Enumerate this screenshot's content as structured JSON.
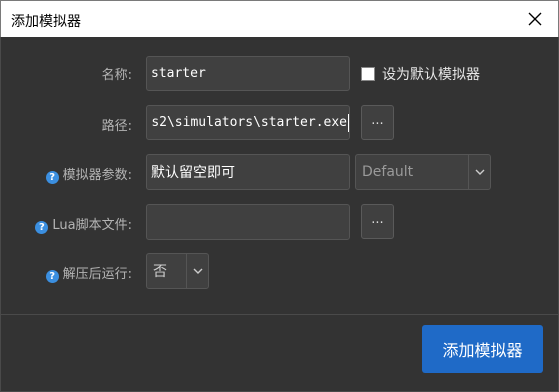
{
  "window": {
    "title": "添加模拟器",
    "close_icon": "close-icon"
  },
  "form": {
    "name": {
      "label": "名称:",
      "value": "starter",
      "default_checkbox_label": "设为默认模拟器",
      "default_checked": false
    },
    "path": {
      "label": "路径:",
      "value": "s2\\simulators\\starter.exe",
      "browse_label": "..."
    },
    "params": {
      "label": "模拟器参数:",
      "help_icon": "help-icon",
      "value": "默认留空即可",
      "preset_value": "Default"
    },
    "lua": {
      "label": "Lua脚本文件:",
      "help_icon": "help-icon",
      "value": "",
      "browse_label": "..."
    },
    "run_after": {
      "label": "解压后运行:",
      "help_icon": "help-icon",
      "value": "否"
    }
  },
  "actions": {
    "submit_label": "添加模拟器"
  },
  "colors": {
    "accent": "#1f6ac7",
    "help": "#3b8fe0",
    "background": "#333333"
  }
}
